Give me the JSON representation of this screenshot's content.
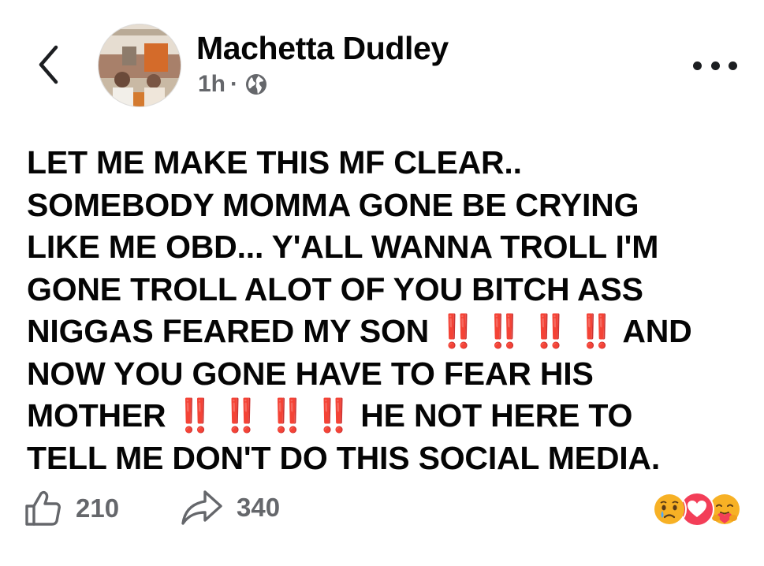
{
  "header": {
    "back_icon": "chevron-left-icon",
    "author_name": "Machetta Dudley",
    "time_ago": "1h",
    "separator": "·",
    "privacy_icon": "globe-icon",
    "more_icon": "more-horizontal-icon"
  },
  "post": {
    "lines": [
      [
        "LET ME MAKE THIS MF CLEAR.."
      ],
      [
        "SOMEBODY MOMMA GONE BE CRYING"
      ],
      [
        "LIKE ME OBD... Y'ALL WANNA TROLL I'M"
      ],
      [
        "GONE TROLL ALOT OF YOU BITCH ASS"
      ],
      [
        "NIGGAS FEARED MY SON",
        "‼️ ‼️ ‼️ ‼️",
        " AND"
      ],
      [
        "NOW YOU GONE HAVE TO FEAR HIS"
      ],
      [
        "MOTHER",
        "‼️ ‼️ ‼️ ‼️",
        " HE NOT HERE TO"
      ],
      [
        "TELL ME DON'T DO THIS SOCIAL MEDIA."
      ]
    ],
    "emphasis_color": "#dd2e44"
  },
  "footer": {
    "like_icon": "thumbs-up-icon",
    "like_count": "210",
    "share_icon": "share-arrow-icon",
    "share_count": "340",
    "reactions": [
      "sad-reaction-icon",
      "love-reaction-icon",
      "care-reaction-icon"
    ]
  },
  "colors": {
    "text": "#050505",
    "secondary": "#65676b",
    "love": "#f33e58",
    "reaction_yellow": "#f7b125"
  }
}
